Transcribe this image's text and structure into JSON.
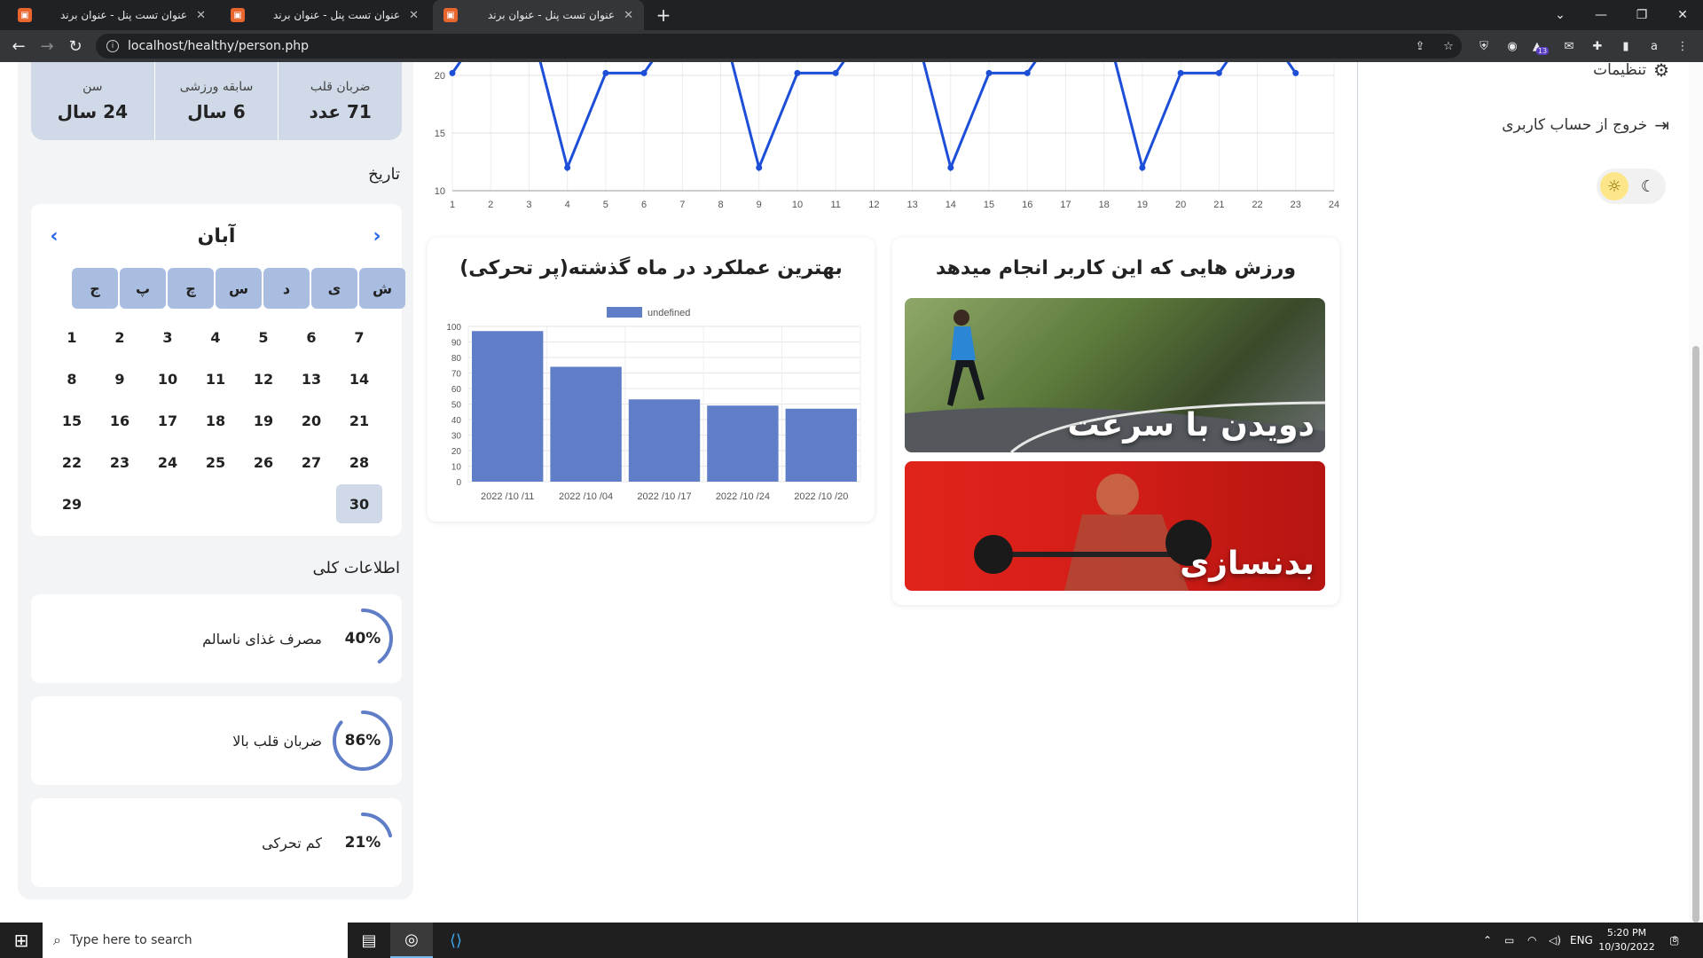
{
  "browser": {
    "tabs": [
      {
        "title": "عنوان تست پنل - عنوان برند",
        "active": false
      },
      {
        "title": "عنوان تست پنل - عنوان برند",
        "active": false
      },
      {
        "title": "عنوان تست پنل - عنوان برند",
        "active": true
      }
    ],
    "url": "localhost/healthy/person.php",
    "profile_initial": "a",
    "ext_badge": "13"
  },
  "stats": [
    {
      "label": "ضربان قلب",
      "value": "71 عدد"
    },
    {
      "label": "سابقه ورزشی",
      "value": "6 سال"
    },
    {
      "label": "سن",
      "value": "24 سال"
    }
  ],
  "history_title": "تاریخ",
  "calendar": {
    "month": "آبان",
    "weekdays": [
      "ش",
      "ی",
      "د",
      "س",
      "چ",
      "پ",
      "ج"
    ],
    "rows": [
      [
        "1",
        "2",
        "3",
        "4",
        "5",
        "6",
        "7"
      ],
      [
        "8",
        "9",
        "10",
        "11",
        "12",
        "13",
        "14"
      ],
      [
        "15",
        "16",
        "17",
        "18",
        "19",
        "20",
        "21"
      ],
      [
        "22",
        "23",
        "24",
        "25",
        "26",
        "27",
        "28"
      ],
      [
        "29",
        "",
        "",
        "",
        "",
        "",
        "30"
      ]
    ],
    "today": "30"
  },
  "overview_title": "اطلاعات کلی",
  "overview": [
    {
      "label": "مصرف غذای ناسالم",
      "percent": 40,
      "text": "40%"
    },
    {
      "label": "ضربان قلب بالا",
      "percent": 86,
      "text": "86%"
    },
    {
      "label": "کم تحرکی",
      "percent": 21,
      "text": "21%"
    }
  ],
  "chart_data": [
    {
      "type": "line",
      "x": [
        1,
        2,
        3,
        4,
        5,
        6,
        7,
        8,
        9,
        10,
        11,
        12,
        13,
        14,
        15,
        16,
        17,
        18,
        19,
        20,
        21,
        22,
        23,
        24
      ],
      "y_ticks": [
        "20",
        "15",
        "10"
      ],
      "ylim": [
        10,
        21
      ],
      "series": [
        {
          "values": [
            20.2,
            25,
            25,
            12,
            20.2,
            20.2,
            25,
            25,
            12,
            20.2,
            20.2,
            25,
            25,
            12,
            20.2,
            20.2,
            25,
            25,
            12,
            20.2,
            20.2,
            25,
            20.2,
            null
          ]
        }
      ],
      "color": "#1d4ed8"
    },
    {
      "type": "bar",
      "title": "بهترین عملکرد در ماه گذشته(پر تحرکی)",
      "legend": "undefined",
      "categories": [
        "2022 /10 /11",
        "2022 /10 /04",
        "2022 /10 /17",
        "2022 /10 /24",
        "2022 /10 /20"
      ],
      "values": [
        97,
        74,
        53,
        49,
        47
      ],
      "y_ticks": [
        "100",
        "90",
        "80",
        "70",
        "60",
        "50",
        "40",
        "30",
        "20",
        "10",
        "0"
      ],
      "ylim": [
        0,
        100
      ],
      "grid": true,
      "color": "#5f7ec7"
    }
  ],
  "sports": {
    "title": "ورزش هایی که این کاربر انجام میدهد",
    "items": [
      {
        "label": "دویدن با سرعت"
      },
      {
        "label": "بدنسازی"
      }
    ]
  },
  "sidebar": {
    "settings": "تنظیمات",
    "logout": "خروج از حساب کاربری"
  },
  "taskbar": {
    "search_placeholder": "Type here to search",
    "lang": "ENG",
    "time": "5:20 PM",
    "date": "10/30/2022",
    "notif_count": "8"
  }
}
